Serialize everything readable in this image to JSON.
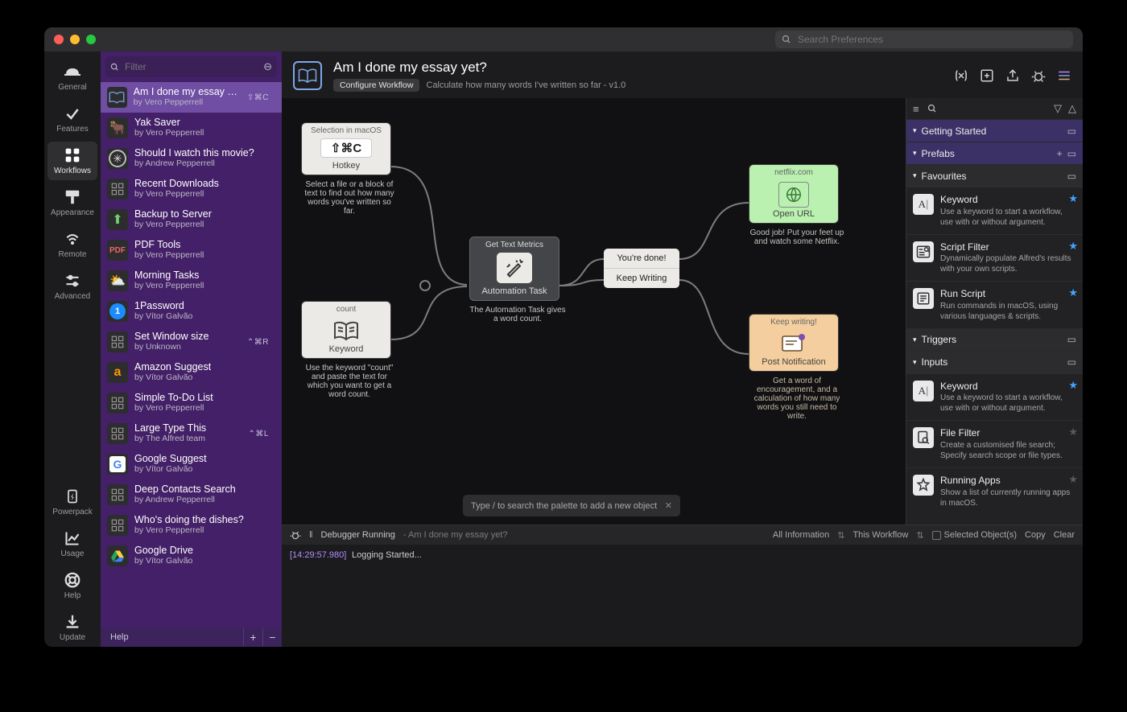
{
  "search_placeholder": "Search Preferences",
  "leftnav": [
    {
      "key": "general",
      "label": "General"
    },
    {
      "key": "features",
      "label": "Features"
    },
    {
      "key": "workflows",
      "label": "Workflows"
    },
    {
      "key": "appearance",
      "label": "Appearance"
    },
    {
      "key": "remote",
      "label": "Remote"
    },
    {
      "key": "advanced",
      "label": "Advanced"
    },
    {
      "key": "powerpack",
      "label": "Powerpack"
    },
    {
      "key": "usage",
      "label": "Usage"
    },
    {
      "key": "help",
      "label": "Help"
    },
    {
      "key": "update",
      "label": "Update"
    }
  ],
  "filter_placeholder": "Filter",
  "workflows": [
    {
      "title": "Am I done my essay yet?",
      "sub": "by Vero Pepperrell",
      "hotkey": "⇧⌘C",
      "sel": true,
      "icon": "book"
    },
    {
      "title": "Yak Saver",
      "sub": "by Vero Pepperrell",
      "icon": "yak"
    },
    {
      "title": "Should I watch this movie?",
      "sub": "by Andrew Pepperrell",
      "icon": "reel"
    },
    {
      "title": "Recent Downloads",
      "sub": "by Vero Pepperrell",
      "icon": "grid"
    },
    {
      "title": "Backup to Server",
      "sub": "by Vero Pepperrell",
      "icon": "up"
    },
    {
      "title": "PDF Tools",
      "sub": "by Vero Pepperrell",
      "icon": "pdf"
    },
    {
      "title": "Morning Tasks",
      "sub": "by Vero Pepperrell",
      "icon": "sun"
    },
    {
      "title": "1Password",
      "sub": "by Vítor Galvão",
      "icon": "onep"
    },
    {
      "title": "Set Window size",
      "sub": "by Unknown",
      "hotkey": "⌃⌘R",
      "icon": "grid"
    },
    {
      "title": "Amazon Suggest",
      "sub": "by Vítor Galvão",
      "icon": "amz"
    },
    {
      "title": "Simple To-Do List",
      "sub": "by Vero Pepperrell",
      "icon": "grid"
    },
    {
      "title": "Large Type This",
      "sub": "by The Alfred team",
      "hotkey": "⌃⌘L",
      "icon": "grid"
    },
    {
      "title": "Google Suggest",
      "sub": "by Vítor Galvão",
      "icon": "goog"
    },
    {
      "title": "Deep Contacts Search",
      "sub": "by Andrew Pepperrell",
      "icon": "grid"
    },
    {
      "title": "Who's doing the dishes?",
      "sub": "by Vero Pepperrell",
      "icon": "grid"
    },
    {
      "title": "Google Drive",
      "sub": "by Vítor Galvão",
      "icon": "drive"
    }
  ],
  "wflist_footer": {
    "help": "Help"
  },
  "header": {
    "title": "Am I done my essay yet?",
    "configure": "Configure Workflow",
    "desc": "Calculate how many words I've written so far - v1.0"
  },
  "nodes": {
    "hotkey": {
      "sel": "Selection in macOS",
      "key": "⇧⌘C",
      "foot": "Hotkey",
      "note": "Select a file or a block of text to find out how many words you've written so far."
    },
    "keyword": {
      "hdr": "count",
      "foot": "Keyword",
      "note": "Use the keyword \"count\" and paste the text for which you want to get a word count."
    },
    "auto": {
      "hdr": "Get Text Metrics",
      "foot": "Automation Task",
      "note": "The Automation Task gives a word count."
    },
    "cond": {
      "a": "You're done!",
      "b": "Keep Writing"
    },
    "open": {
      "hdr": "netflix.com",
      "foot": "Open URL",
      "note": "Good job! Put your feet up and watch some Netflix."
    },
    "notif": {
      "hdr": "Keep writing!",
      "foot": "Post Notification",
      "note": "Get a word of encouragement, and a calculation of how many words you still need to write."
    }
  },
  "palette_hint": "Type / to search the palette to add a new object",
  "palette": {
    "sections": [
      {
        "label": "Getting Started",
        "style": "purple",
        "right": [
          "▭"
        ]
      },
      {
        "label": "Prefabs",
        "style": "purple",
        "right": [
          "+",
          "▭"
        ]
      },
      {
        "label": "Favourites",
        "style": "dark",
        "right": [
          "▭"
        ],
        "items": [
          {
            "name": "Keyword",
            "desc": "Use a keyword to start a workflow, use with or without argument.",
            "star": true,
            "icon": "A|"
          },
          {
            "name": "Script Filter",
            "desc": "Dynamically populate Alfred's results with your own scripts.",
            "star": true,
            "icon": "list"
          },
          {
            "name": "Run Script",
            "desc": "Run commands in macOS, using various languages & scripts.",
            "star": true,
            "icon": "script"
          }
        ]
      },
      {
        "label": "Triggers",
        "style": "dark",
        "right": [
          "▭"
        ]
      },
      {
        "label": "Inputs",
        "style": "dark",
        "right": [
          "▭"
        ],
        "items": [
          {
            "name": "Keyword",
            "desc": "Use a keyword to start a workflow, use with or without argument.",
            "star": true,
            "icon": "A|"
          },
          {
            "name": "File Filter",
            "desc": "Create a customised file search; Specify search scope or file types.",
            "star": false,
            "icon": "file"
          },
          {
            "name": "Running Apps",
            "desc": "Show a list of currently running apps in macOS.",
            "star": false,
            "icon": "app"
          }
        ]
      }
    ]
  },
  "debugger": {
    "status": "Debugger Running",
    "context": "Am I done my essay yet?",
    "info_label": "All Information",
    "scope": "This Workflow",
    "selected": "Selected Object(s)",
    "copy": "Copy",
    "clear": "Clear",
    "ts": "[14:29:57.980]",
    "msg": "Logging Started..."
  }
}
